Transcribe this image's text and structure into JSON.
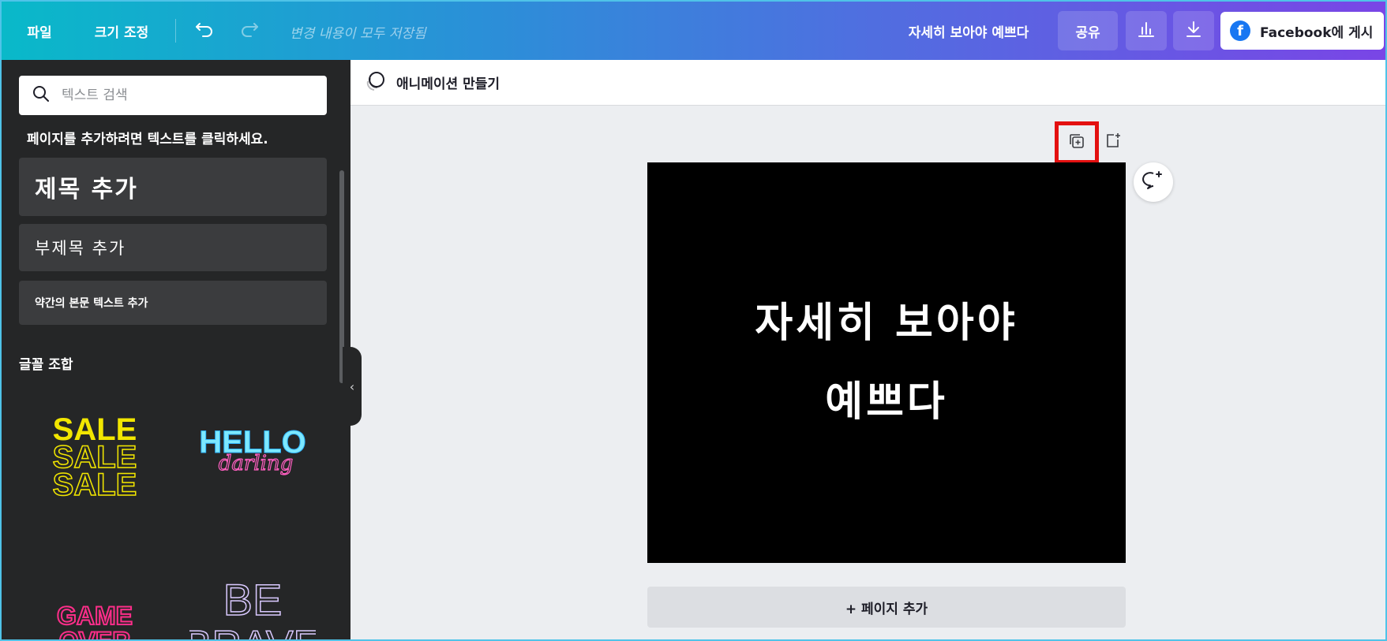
{
  "topbar": {
    "file_label": "파일",
    "resize_label": "크기 조정",
    "save_status": "변경 내용이 모두 저장됨",
    "design_title": "자세히 보아야 예쁘다",
    "share_label": "공유",
    "facebook_post_label": "Facebook에 게시"
  },
  "sidebar": {
    "search_placeholder": "텍스트 검색",
    "hint": "페이지를 추가하려면 텍스트를 클릭하세요.",
    "heading_card": "제목 추가",
    "subheading_card": "부제목 추가",
    "body_card": "약간의 본문 텍스트 추가",
    "font_combos_title": "글꼴 조합",
    "combos": {
      "sale": "SALE",
      "hello": "HELLO",
      "darling": "darling",
      "game": "GAME",
      "over": "OVER",
      "be": "BE",
      "brave": "BRAVE"
    }
  },
  "canvas": {
    "animate_label": "애니메이션 만들기",
    "design_lines": [
      "자세히 보아야",
      "예쁘다"
    ],
    "add_page_label": "+ 페이지 추가"
  },
  "colors": {
    "highlight": "#e31010",
    "sale_yellow": "#f2e600",
    "hello_cyan": "#7de8ff",
    "darling_pink": "#ff5fc1",
    "game_magenta": "#ff2e8a"
  },
  "icons": {
    "undo": "undo-icon",
    "redo": "redo-icon",
    "stats": "bar-chart-icon",
    "download": "download-icon",
    "facebook": "facebook-icon",
    "search": "search-icon",
    "animate": "animate-icon",
    "copy_page": "copy-page-icon",
    "add_page": "add-page-icon",
    "comment": "add-comment-icon",
    "collapse": "chevron-left-icon"
  }
}
